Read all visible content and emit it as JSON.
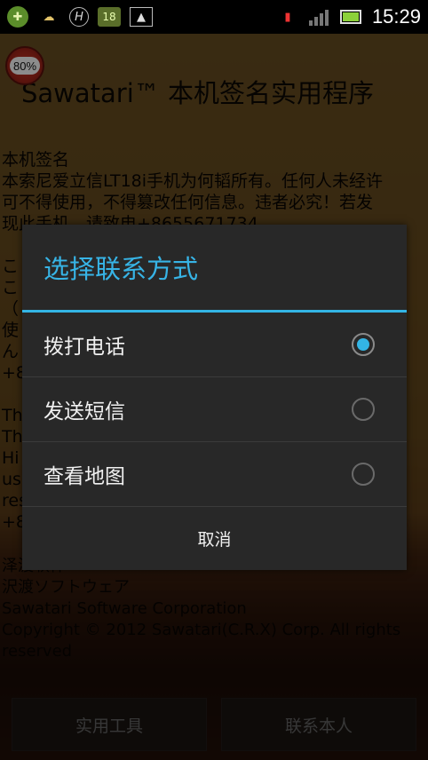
{
  "status_bar": {
    "icons_left": [
      "recycle-icon",
      "weather-icon",
      "h-icon",
      "sim-icon",
      "image-icon"
    ],
    "sim_label": "18",
    "clock": "15:29",
    "icons_right": [
      "no-sim-icon",
      "signal-icon",
      "battery-icon"
    ]
  },
  "app": {
    "badge_text": "80%",
    "title": "Sawatari™ 本机签名实用程序",
    "body_lines": [
      "本机签名",
      "本索尼爱立信LT18i手机为何韬所有。任何人未经许",
      "可不得使用，不得篡改任何信息。违者必究！若发",
      "现此手机，请致电+8655671734..."
    ],
    "bg_fragments_left": [
      "こ",
      "こ",
      "（",
      "使",
      "ん",
      "+8",
      "",
      "Th",
      "Th",
      "Hi",
      "us",
      "res",
      "+8"
    ],
    "footer_lines": [
      "泽渡软件",
      "沢渡ソフトウェア",
      "Sawatari Software Corporation",
      "Copyright © 2012 Sawatari(C.R.X) Corp. All rights",
      "reserved"
    ],
    "bottom_buttons": [
      "实用工具",
      "联系本人"
    ]
  },
  "dialog": {
    "title": "选择联系方式",
    "options": [
      {
        "label": "拨打电话",
        "selected": true
      },
      {
        "label": "发送短信",
        "selected": false
      },
      {
        "label": "查看地图",
        "selected": false
      }
    ],
    "cancel_label": "取消"
  },
  "colors": {
    "accent": "#33b5e5",
    "dialog_bg": "#282828"
  }
}
